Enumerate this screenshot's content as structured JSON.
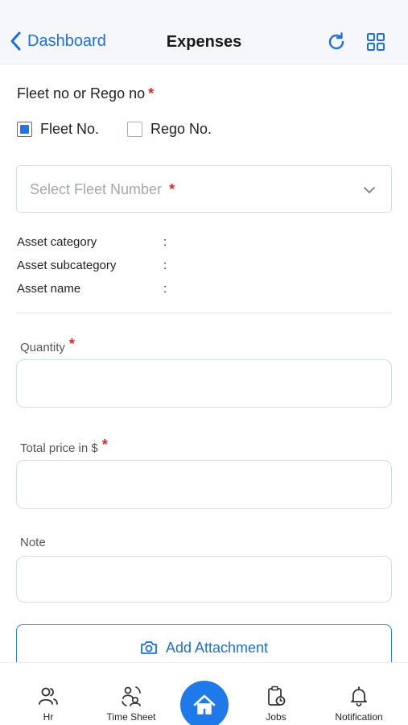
{
  "header": {
    "back_label": "Dashboard",
    "title": "Expenses"
  },
  "fleet": {
    "title": "Fleet no or Rego no",
    "required_mark": "*",
    "options": [
      {
        "label": "Fleet No.",
        "checked": true
      },
      {
        "label": "Rego No.",
        "checked": false
      }
    ],
    "select_placeholder": "Select Fleet Number",
    "select_required_mark": "*"
  },
  "asset": {
    "rows": [
      {
        "label": "Asset category",
        "sep": ":"
      },
      {
        "label": "Asset subcategory",
        "sep": ":"
      },
      {
        "label": "Asset name",
        "sep": ":"
      }
    ]
  },
  "form": {
    "quantity_label": "Quantity",
    "quantity_required": "*",
    "quantity_value": "",
    "total_price_label": "Total price in $",
    "total_price_required": "*",
    "total_price_value": "",
    "note_label": "Note",
    "note_value": "",
    "attachment_label": "Add Attachment"
  },
  "tabbar": {
    "items": [
      {
        "label": "Hr",
        "icon": "people-icon"
      },
      {
        "label": "Time Sheet",
        "icon": "timesheet-icon"
      },
      {
        "label": "",
        "icon": "home-icon"
      },
      {
        "label": "Jobs",
        "icon": "jobs-clipboard-icon"
      },
      {
        "label": "Notification",
        "icon": "bell-icon"
      }
    ]
  },
  "colors": {
    "accent": "#1e7ae9",
    "required": "#e0262b",
    "input_border": "#cde3d7",
    "header_bg": "#f6f7fa"
  }
}
